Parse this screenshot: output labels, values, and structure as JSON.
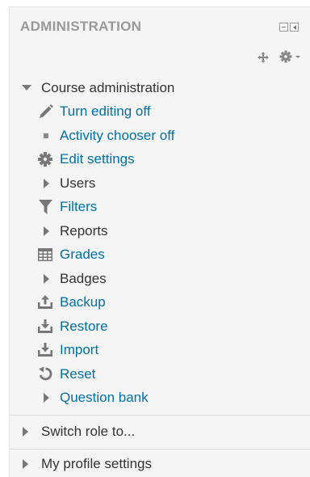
{
  "block": {
    "title": "ADMINISTRATION",
    "minimize_icon": "minus-square-icon",
    "dock_icon": "dock-icon",
    "move_icon": "move-arrows-icon",
    "actions_icon": "gear-dropdown-icon"
  },
  "course_admin": {
    "label": "Course administration",
    "items": [
      {
        "label": "Turn editing off",
        "icon": "pencil-icon",
        "link": true
      },
      {
        "label": "Activity chooser off",
        "icon": "bullet-icon",
        "link": true
      },
      {
        "label": "Edit settings",
        "icon": "gear-icon",
        "link": true
      },
      {
        "label": "Users",
        "icon": "expand-arrow-icon",
        "link": false
      },
      {
        "label": "Filters",
        "icon": "filter-icon",
        "link": true
      },
      {
        "label": "Reports",
        "icon": "expand-arrow-icon",
        "link": false
      },
      {
        "label": "Grades",
        "icon": "grades-table-icon",
        "link": true
      },
      {
        "label": "Badges",
        "icon": "expand-arrow-icon",
        "link": false
      },
      {
        "label": "Backup",
        "icon": "backup-icon",
        "link": true
      },
      {
        "label": "Restore",
        "icon": "restore-icon",
        "link": true
      },
      {
        "label": "Import",
        "icon": "import-icon",
        "link": true
      },
      {
        "label": "Reset",
        "icon": "reset-icon",
        "link": true
      },
      {
        "label": "Question bank",
        "icon": "expand-arrow-icon",
        "link": true
      }
    ]
  },
  "bottom": {
    "switch_role": "Switch role to...",
    "profile_settings": "My profile settings"
  },
  "colors": {
    "link": "#0070a8",
    "text": "#333333",
    "title": "#999999",
    "block_bg": "#f5f5f5",
    "icon": "#777777"
  }
}
